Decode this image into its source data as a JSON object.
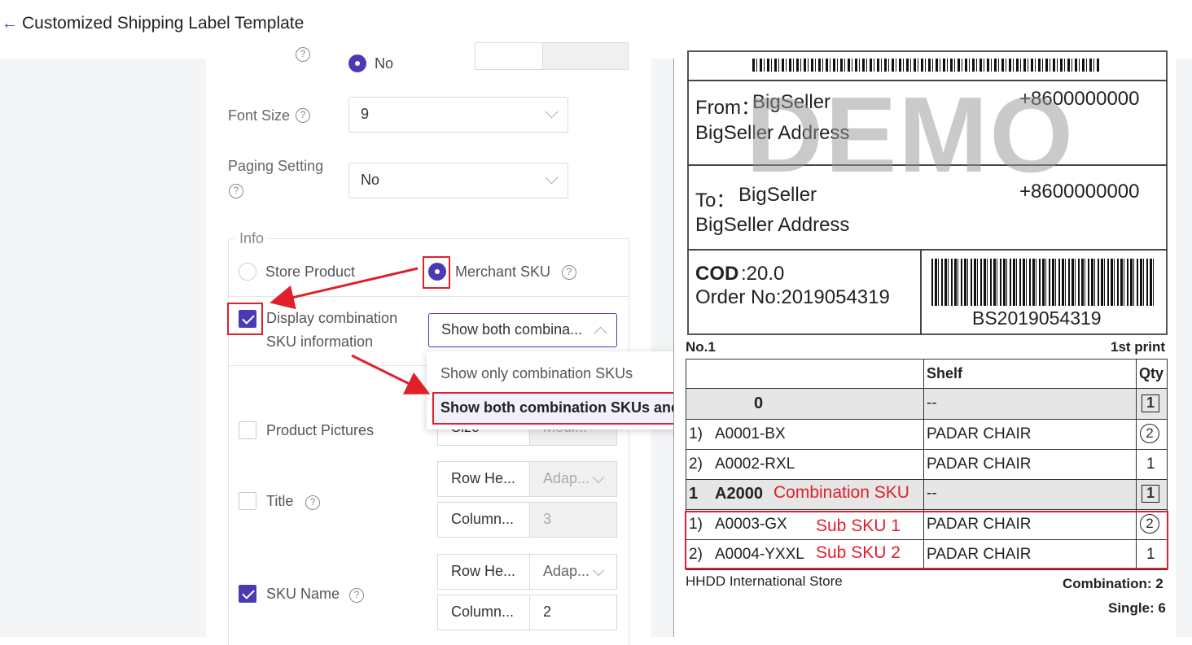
{
  "header": {
    "back_icon": "arrow-left-icon",
    "title": "Customized Shipping Label Template"
  },
  "settings": {
    "radio_no_label": "No",
    "font_size": {
      "label": "Font Size",
      "value": "9"
    },
    "paging": {
      "label": "Paging Setting",
      "value": "No"
    },
    "info": {
      "legend": "Info",
      "store_product": "Store Product",
      "merchant_sku": "Merchant SKU",
      "display_combo_line1": "Display combination",
      "display_combo_line2": "SKU information",
      "combo_select_value": "Show both combina..."
    },
    "dropdown": {
      "options": [
        "Show only combination SKUs",
        "Show both combination SKUs and sub-SKUs"
      ]
    },
    "product_pictures": {
      "label": "Product Pictures",
      "size_label": "Size",
      "size_value": "Medi..."
    },
    "title_row": {
      "label": "Title",
      "row_height_label": "Row He...",
      "row_height_value": "Adap...",
      "column_label": "Column...",
      "column_value": "3"
    },
    "sku_name": {
      "label": "SKU Name",
      "row_height_label": "Row He...",
      "row_height_value": "Adap...",
      "column_label": "Column...",
      "column_value": "2"
    }
  },
  "preview": {
    "watermark": "DEMO",
    "from_label": "From：",
    "from_name": "BigSeller",
    "from_phone": "+8600000000",
    "from_address": "BigSeller Address",
    "to_label": "To：",
    "to_name": "BigSeller",
    "to_phone": "+8600000000",
    "to_address": "BigSeller Address",
    "cod_label": "COD",
    "cod_value": ":20.0",
    "order_no": "Order No:2019054319",
    "barcode_text": "BS2019054319",
    "no_label": "No.1",
    "print_label": "1st print",
    "table": {
      "headers": [
        "Shelf",
        "Qty"
      ],
      "rows": [
        {
          "idx": "",
          "sku": "0",
          "shelf": "--",
          "qty": "1",
          "qty_style": "box",
          "bold": true
        },
        {
          "idx": "1)",
          "sku": "A0001-BX",
          "shelf": "PADAR CHAIR",
          "qty": "2",
          "qty_style": "circle",
          "bold": false
        },
        {
          "idx": "2)",
          "sku": "A0002-RXL",
          "shelf": "PADAR CHAIR",
          "qty": "1",
          "qty_style": "plain",
          "bold": false
        },
        {
          "idx": "1",
          "sku": "A2000",
          "shelf": "--",
          "qty": "1",
          "qty_style": "box",
          "bold": true
        },
        {
          "idx": "1)",
          "sku": "A0003-GX",
          "shelf": "PADAR CHAIR",
          "qty": "2",
          "qty_style": "circle",
          "bold": false
        },
        {
          "idx": "2)",
          "sku": "A0004-YXXL",
          "shelf": "PADAR CHAIR",
          "qty": "1",
          "qty_style": "plain",
          "bold": false
        }
      ]
    },
    "annotations": {
      "combination": "Combination SKU",
      "sub1": "Sub SKU 1",
      "sub2": "Sub SKU 2"
    },
    "store_name": "HHDD International Store",
    "combination_count": "Combination: 2",
    "single_count": "Single: 6"
  },
  "colors": {
    "accent": "#4a3bb5",
    "highlight": "#e0202a"
  }
}
